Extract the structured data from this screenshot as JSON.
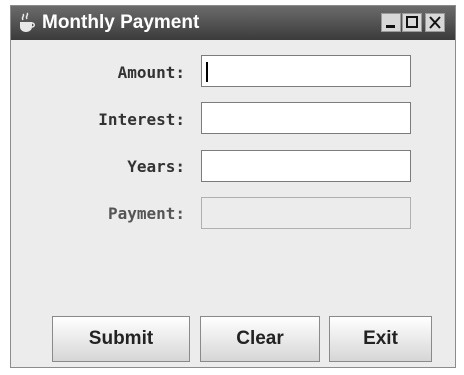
{
  "window": {
    "title": "Monthly Payment",
    "icon": "java-coffee-cup-icon",
    "controls": [
      "minimize-icon",
      "maximize-icon",
      "close-icon"
    ]
  },
  "form": {
    "amount": {
      "label": "Amount:",
      "value": ""
    },
    "interest": {
      "label": "Interest:",
      "value": ""
    },
    "years": {
      "label": "Years:",
      "value": ""
    },
    "payment": {
      "label": "Payment:",
      "value": ""
    }
  },
  "buttons": {
    "submit": "Submit",
    "clear": "Clear",
    "exit": "Exit"
  }
}
